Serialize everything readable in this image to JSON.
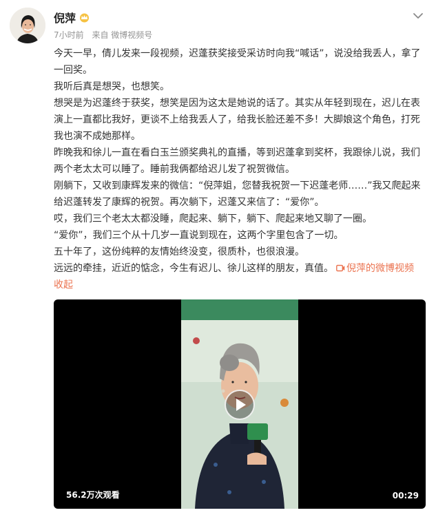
{
  "post": {
    "author": {
      "name": "倪萍",
      "badge_icon": "crown-icon"
    },
    "meta": {
      "time": "7小时前",
      "source": "来自 微博视频号"
    },
    "menu_icon": "chevron-down-icon",
    "body": {
      "paragraphs": [
        "今天一早，倩儿发来一段视频，迟蓬获奖接受采访时向我“喊话”，说没给我丢人，拿了一回奖。",
        "我听后真是想哭，也想笑。",
        "想哭是为迟蓬终于获奖，想笑是因为这太是她说的话了。其实从年轻到现在，迟儿在表演上一直都比我好，更谈不上给我丢人了，给我长脸还差不多！大脚娘这个角色，打死我也演不成她那样。",
        "昨晚我和徐儿一直在看白玉兰颁奖典礼的直播，等到迟蓬拿到奖杯，我跟徐儿说，我们两个老太太可以睡了。睡前我俩都给迟儿发了祝贺微信。",
        "刚躺下，又收到康辉发来的微信：“倪萍姐，您替我祝贺一下迟蓬老师……”我又爬起来给迟蓬转发了康辉的祝贺。再次躺下，迟蓬又来信了：“爱你”。",
        "哎，我们三个老太太都没睡，爬起来、躺下，躺下、爬起来地又聊了一圈。",
        "“爱你”，我们三个从十几岁一直说到现在，这两个字里包含了一切。",
        "五十年了，这份纯粹的友情始终没变，很质朴，也很浪漫。"
      ],
      "last_paragraph": "远远的牵挂，近近的惦念，今生有迟儿、徐儿这样的朋友，真值。",
      "video_link": "倪萍的微博视频",
      "collapse": "收起",
      "link_icon": "video-link-icon"
    },
    "video": {
      "views": "56.2万次观看",
      "duration": "00:29",
      "play_icon": "play-icon"
    },
    "colors": {
      "link": "#eb7350",
      "text": "#333333",
      "meta": "#939393",
      "video_bg": "#000000"
    }
  }
}
